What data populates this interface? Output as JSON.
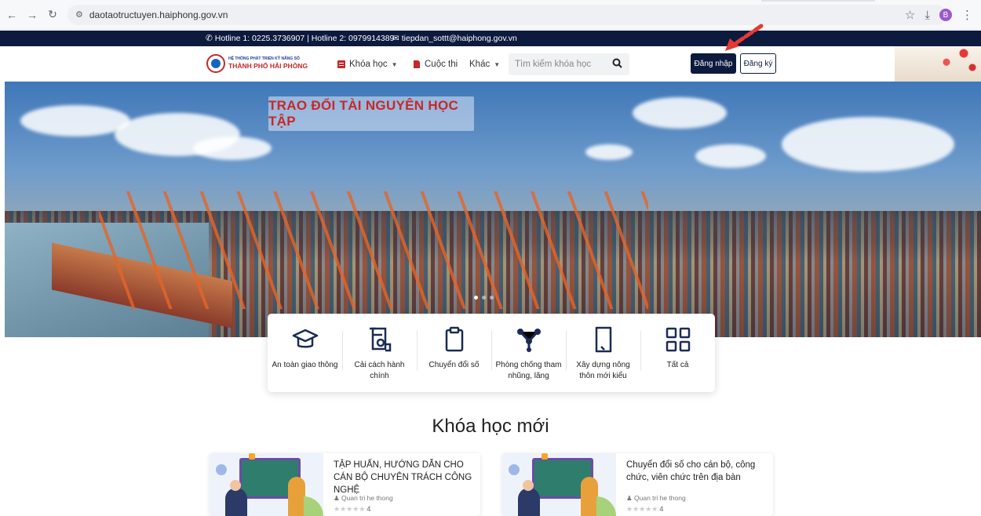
{
  "browser": {
    "url": "daotaotructuyen.haiphong.gov.vn",
    "profile_initial": "B"
  },
  "topbar": {
    "hotline": "Hotline 1: 0225.3736907 | Hotline 2: 0979914389",
    "email": "tiepdan_sottt@haiphong.gov.vn"
  },
  "header": {
    "logo_small": "HỆ THỐNG PHÁT TRIỂN KỸ NĂNG SỐ",
    "logo_big": "THÀNH PHỐ HẢI PHÒNG",
    "menu": {
      "courses": "Khóa học",
      "contest": "Cuộc thi",
      "other": "Khác"
    },
    "search_placeholder": "Tìm kiếm khóa học",
    "login": "Đăng nhập",
    "register": "Đăng ký"
  },
  "hero": {
    "title": "TRAO ĐỔI TÀI NGUYÊN HỌC TẬP"
  },
  "categories": [
    {
      "label": "An toàn giao thông",
      "icon": "graduation-cap-icon"
    },
    {
      "label": "Cải cách hành chính",
      "icon": "document-scroll-icon"
    },
    {
      "label": "Chuyển đổi số",
      "icon": "clipboard-icon"
    },
    {
      "label": "Phòng chống tham nhũng, lãng",
      "icon": "network-icon"
    },
    {
      "label": "Xây dựng nông thôn mới kiểu",
      "icon": "tablet-icon"
    },
    {
      "label": "Tất cả",
      "icon": "grid-icon"
    }
  ],
  "section_title": "Khóa học mới",
  "courses": [
    {
      "title": "TẬP HUẤN, HƯỚNG DẪN CHO CÁN BỘ CHUYÊN TRÁCH CÔNG NGHỆ",
      "author": "Quan tri he thong",
      "rating": "4"
    },
    {
      "title": "Chuyển đổi số cho cán bộ, công chức, viên chức trên địa bàn",
      "author": "Quan tri he thong",
      "rating": "4"
    }
  ],
  "colors": {
    "navy": "#0c1a3d",
    "brand_red": "#c62828"
  }
}
